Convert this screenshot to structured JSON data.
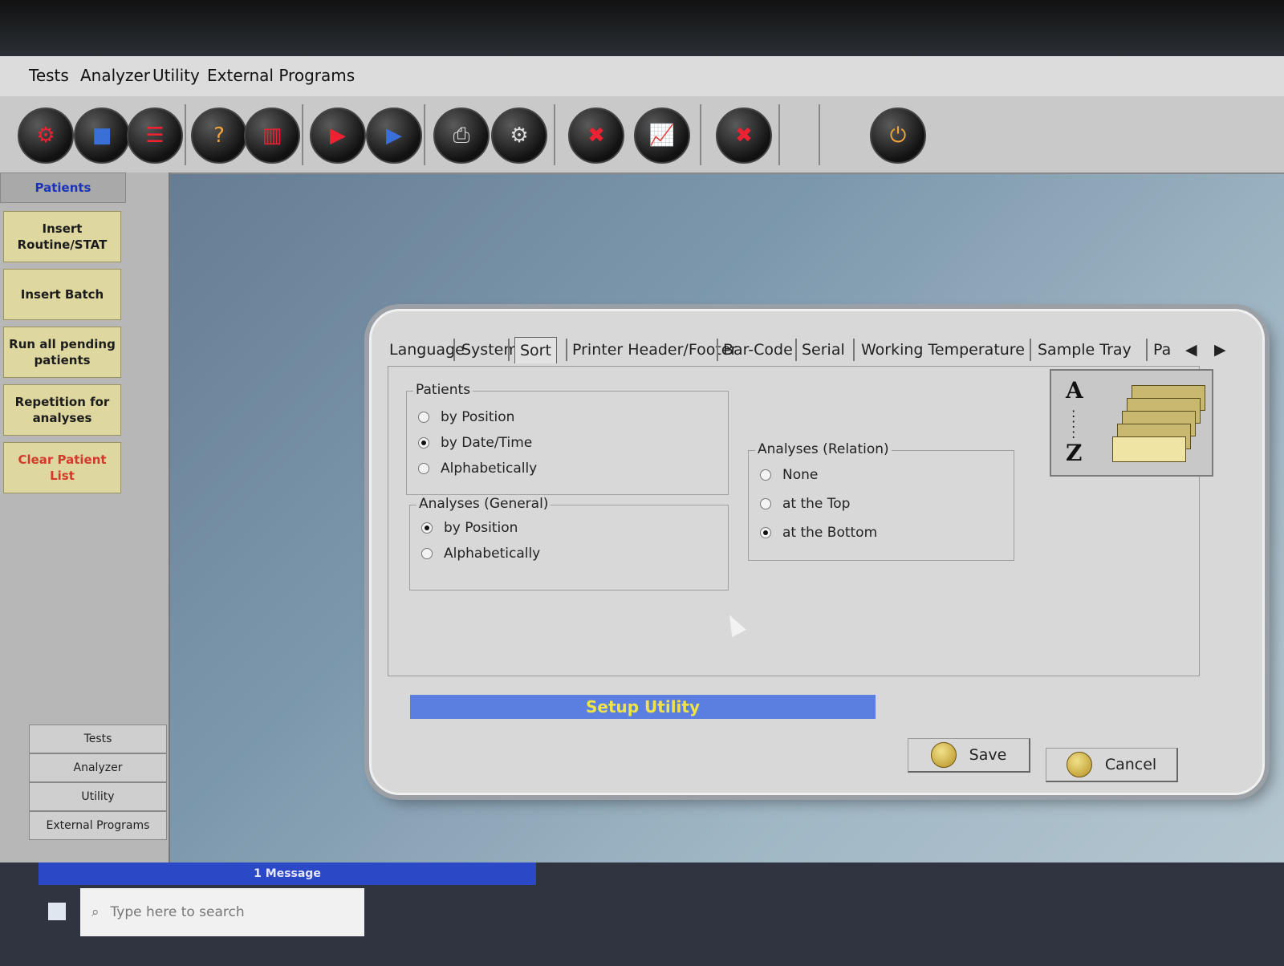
{
  "menu": [
    "Tests",
    "Analyzer",
    "Utility",
    "External Programs"
  ],
  "sidebar": {
    "header": "Patients",
    "buttons": [
      "Insert Routine/STAT",
      "Insert Batch",
      "Run all pending patients",
      "Repetition for analyses",
      "Clear Patient List"
    ],
    "nav": [
      "Tests",
      "Analyzer",
      "Utility",
      "External Programs"
    ]
  },
  "dialog": {
    "tabs": [
      "Language",
      "System",
      "Sort",
      "Printer Header/Footer",
      "Bar-Code",
      "Serial",
      "Working Temperature",
      "Sample Tray",
      "Pa"
    ],
    "active_tab": "Sort",
    "groups": {
      "patients": {
        "title": "Patients",
        "options": [
          "by Position",
          "by Date/Time",
          "Alphabetically"
        ],
        "selected": "by Date/Time"
      },
      "analyses_general": {
        "title": "Analyses (General)",
        "options": [
          "by Position",
          "Alphabetically"
        ],
        "selected": "by Position"
      },
      "analyses_relation": {
        "title": "Analyses (Relation)",
        "options": [
          "None",
          "at the Top",
          "at the Bottom"
        ],
        "selected": "at the Bottom"
      }
    },
    "az_labels": {
      "top": "A",
      "bottom": "Z"
    },
    "status_text": "Setup Utility",
    "save_label": "Save",
    "cancel_label": "Cancel"
  },
  "taskbar": {
    "message": "1 Message",
    "search_placeholder": "Type here to search"
  },
  "colors": {
    "sidebar_button": "#ded7a0",
    "status_bar": "#5b7fe0",
    "status_text": "#f0e34a",
    "clear_list_text": "#d23b2b",
    "sidebar_header": "#1a33b8"
  }
}
